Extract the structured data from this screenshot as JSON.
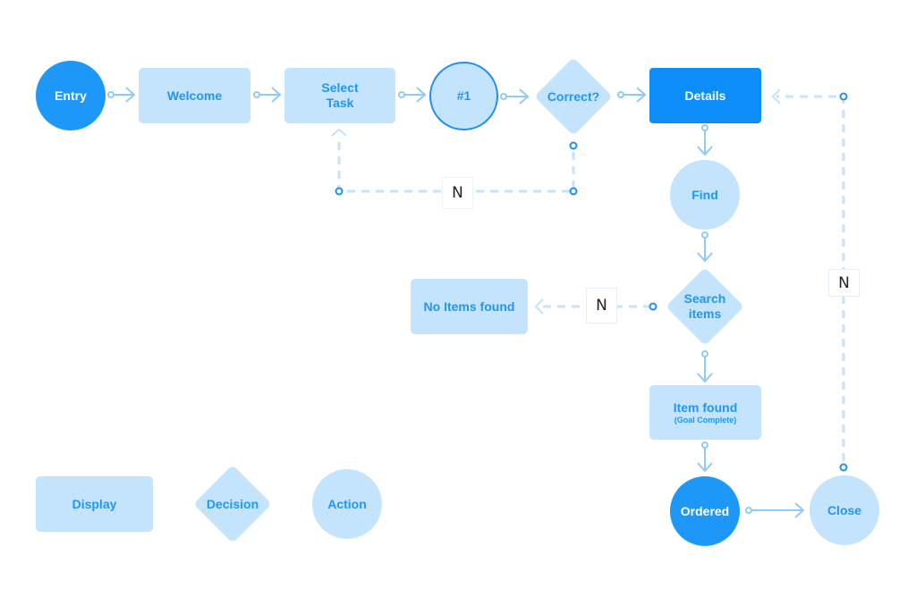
{
  "diagram": {
    "colors": {
      "light_fill": "#c4e3fd",
      "dark_fill": "#1e98f8",
      "accent_text": "#2196f3",
      "connector": "#90caf9",
      "dashed": "#c4e3fd",
      "port": "#1e8ff5"
    },
    "nodes": {
      "entry": {
        "label": "Entry",
        "shape": "circle",
        "style": "filled"
      },
      "welcome": {
        "label": "Welcome",
        "shape": "rectangle"
      },
      "select_task": {
        "label": "Select Task",
        "shape": "rectangle"
      },
      "step1": {
        "label": "#1",
        "shape": "circle",
        "style": "outlined"
      },
      "correct": {
        "label": "Correct?",
        "shape": "diamond"
      },
      "details": {
        "label": "Details",
        "shape": "rectangle",
        "style": "filled"
      },
      "find": {
        "label": "Find",
        "shape": "circle"
      },
      "search_items": {
        "label": "Search items",
        "shape": "diamond"
      },
      "no_items_found": {
        "label": "No Items found",
        "shape": "rectangle"
      },
      "item_found": {
        "label": "Item found",
        "sublabel": "(Goal Complete)",
        "shape": "rectangle"
      },
      "ordered": {
        "label": "Ordered",
        "shape": "circle",
        "style": "filled"
      },
      "close": {
        "label": "Close",
        "shape": "circle"
      }
    },
    "edges": [
      {
        "from": "entry",
        "to": "welcome",
        "style": "solid"
      },
      {
        "from": "welcome",
        "to": "select_task",
        "style": "solid"
      },
      {
        "from": "select_task",
        "to": "step1",
        "style": "solid"
      },
      {
        "from": "step1",
        "to": "correct",
        "style": "solid"
      },
      {
        "from": "correct",
        "to": "details",
        "style": "solid"
      },
      {
        "from": "correct",
        "to": "select_task",
        "style": "dashed",
        "label": "N"
      },
      {
        "from": "details",
        "to": "find",
        "style": "solid"
      },
      {
        "from": "find",
        "to": "search_items",
        "style": "solid"
      },
      {
        "from": "search_items",
        "to": "no_items_found",
        "style": "dashed",
        "label": "N"
      },
      {
        "from": "search_items",
        "to": "item_found",
        "style": "solid"
      },
      {
        "from": "item_found",
        "to": "ordered",
        "style": "solid"
      },
      {
        "from": "ordered",
        "to": "close",
        "style": "solid"
      },
      {
        "from": "close",
        "to": "details",
        "style": "dashed",
        "label": "N"
      }
    ],
    "edge_labels": {
      "correct_no": "N",
      "search_no": "N",
      "close_no": "N"
    },
    "legend": {
      "display": "Display",
      "decision": "Decision",
      "action": "Action"
    }
  }
}
